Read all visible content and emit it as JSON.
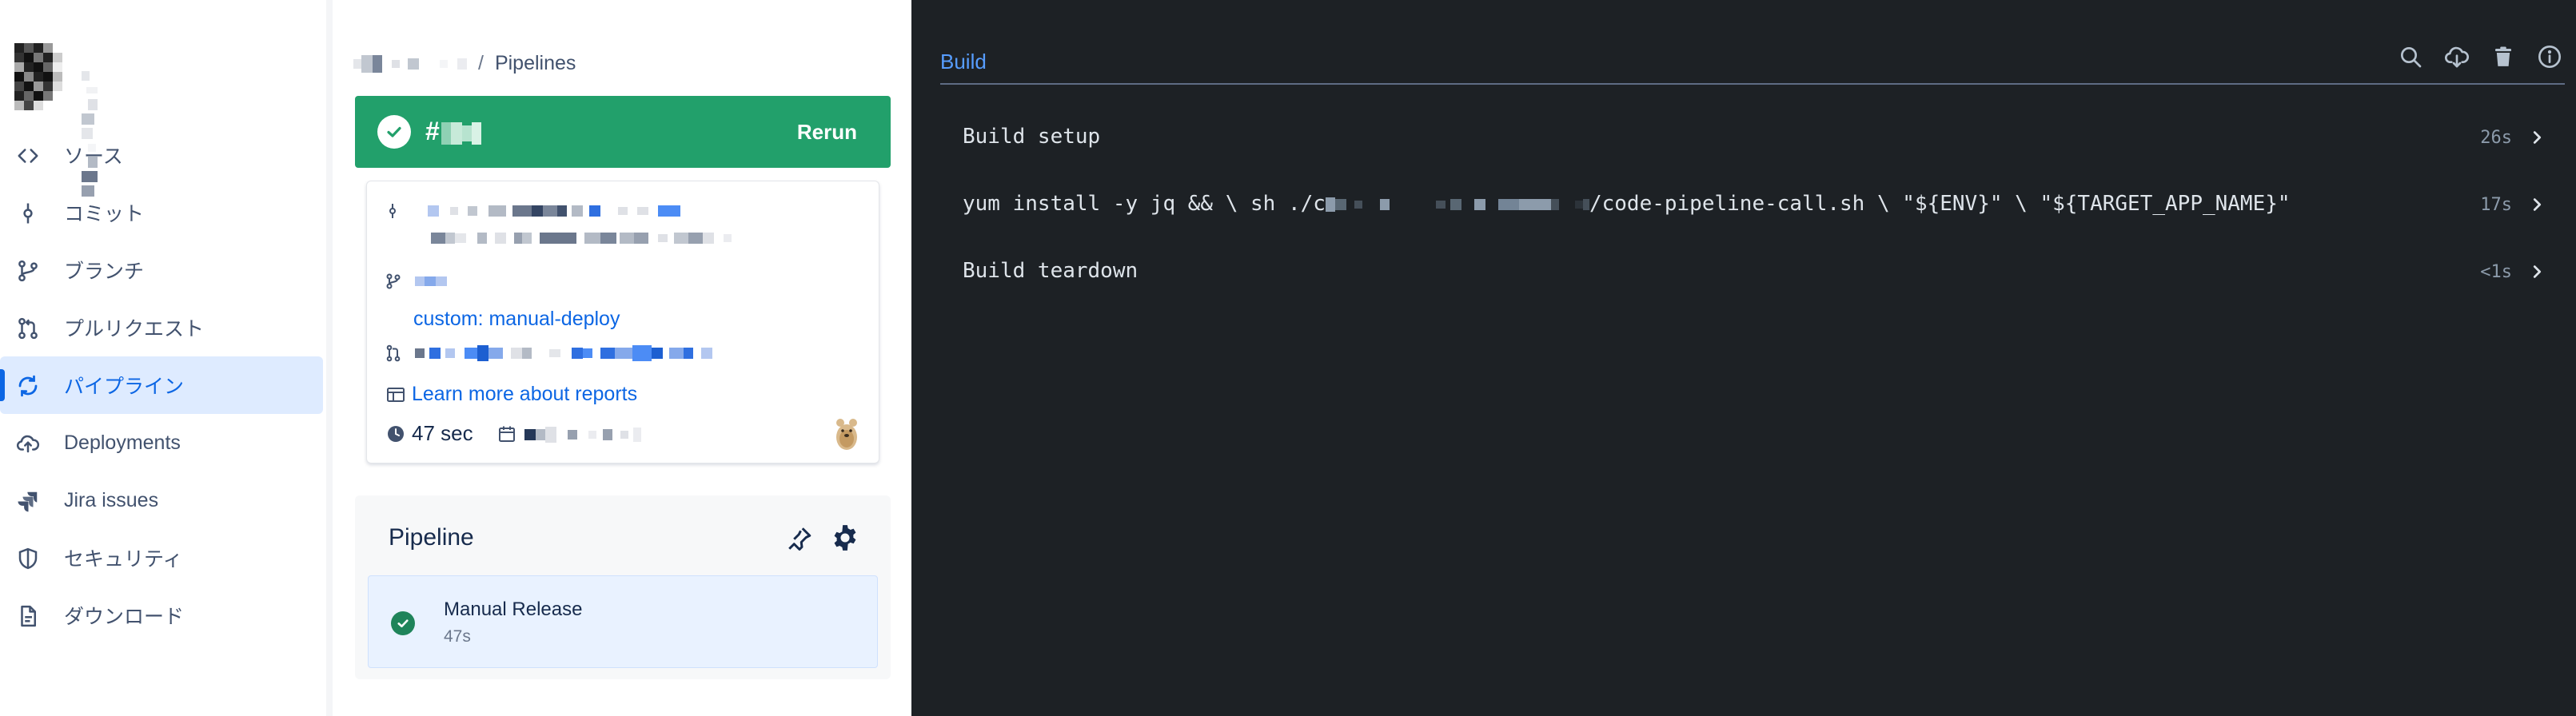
{
  "breadcrumb": {
    "current": "Pipelines",
    "separator": "/"
  },
  "sidebar": {
    "items": [
      {
        "label": "ソース",
        "icon": "code-icon"
      },
      {
        "label": "コミット",
        "icon": "commit-icon"
      },
      {
        "label": "ブランチ",
        "icon": "branch-icon"
      },
      {
        "label": "プルリクエスト",
        "icon": "pull-request-icon"
      },
      {
        "label": "パイプライン",
        "icon": "pipeline-icon",
        "active": true
      },
      {
        "label": "Deployments",
        "icon": "cloud-upload-icon"
      },
      {
        "label": "Jira issues",
        "icon": "jira-icon"
      },
      {
        "label": "セキュリティ",
        "icon": "shield-icon"
      },
      {
        "label": "ダウンロード",
        "icon": "file-icon"
      }
    ]
  },
  "run": {
    "number_prefix": "#",
    "status": "successful",
    "rerun_label": "Rerun",
    "branch_label": "custom: manual-deploy",
    "reports_link": "Learn more about reports",
    "duration": "47 sec"
  },
  "pipeline": {
    "title": "Pipeline",
    "steps": [
      {
        "name": "Manual Release",
        "time": "47s",
        "status": "successful"
      }
    ]
  },
  "log": {
    "tab_label": "Build",
    "toolbar": [
      "search-icon",
      "download-icon",
      "delete-icon",
      "info-icon"
    ],
    "steps": [
      {
        "command": "Build setup",
        "duration": "26s"
      },
      {
        "command_start": "yum install -y jq && \\ sh ./c",
        "command_end": "/code-pipeline-call.sh \\ \"${ENV}\" \\ \"${TARGET_APP_NAME}\"",
        "duration": "17s"
      },
      {
        "command": "Build teardown",
        "duration": "<1s"
      }
    ]
  },
  "colors": {
    "success": "#22a06b",
    "link": "#0c66e4",
    "active_bg": "#deebff",
    "log_bg": "#1d2125",
    "log_text": "#dee4ea"
  }
}
